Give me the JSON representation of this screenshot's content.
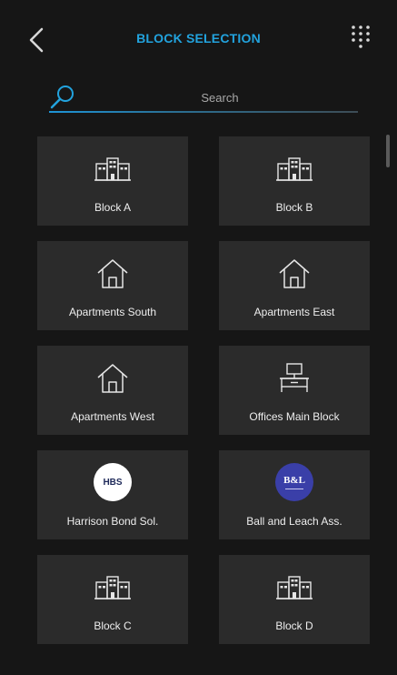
{
  "header": {
    "title": "BLOCK SELECTION",
    "back_icon": "chevron-left-icon",
    "menu_icon": "grid-menu-icon"
  },
  "search": {
    "placeholder": "Search",
    "value": ""
  },
  "colors": {
    "accent": "#22a3de",
    "tile": "#2b2b2b",
    "background": "#161616"
  },
  "tiles": [
    {
      "label": "Block A",
      "icon": "building-icon"
    },
    {
      "label": "Block B",
      "icon": "building-icon"
    },
    {
      "label": "Apartments South",
      "icon": "house-icon"
    },
    {
      "label": "Apartments East",
      "icon": "house-icon"
    },
    {
      "label": "Apartments West",
      "icon": "house-icon"
    },
    {
      "label": "Offices Main Block",
      "icon": "office-desk-icon"
    },
    {
      "label": "Harrison Bond Sol.",
      "icon": "hbs-logo",
      "logo_text": "HBS"
    },
    {
      "label": "Ball and Leach Ass.",
      "icon": "bl-logo",
      "logo_text": "B&L"
    },
    {
      "label": "Block C",
      "icon": "building-icon"
    },
    {
      "label": "Block D",
      "icon": "building-icon"
    }
  ]
}
